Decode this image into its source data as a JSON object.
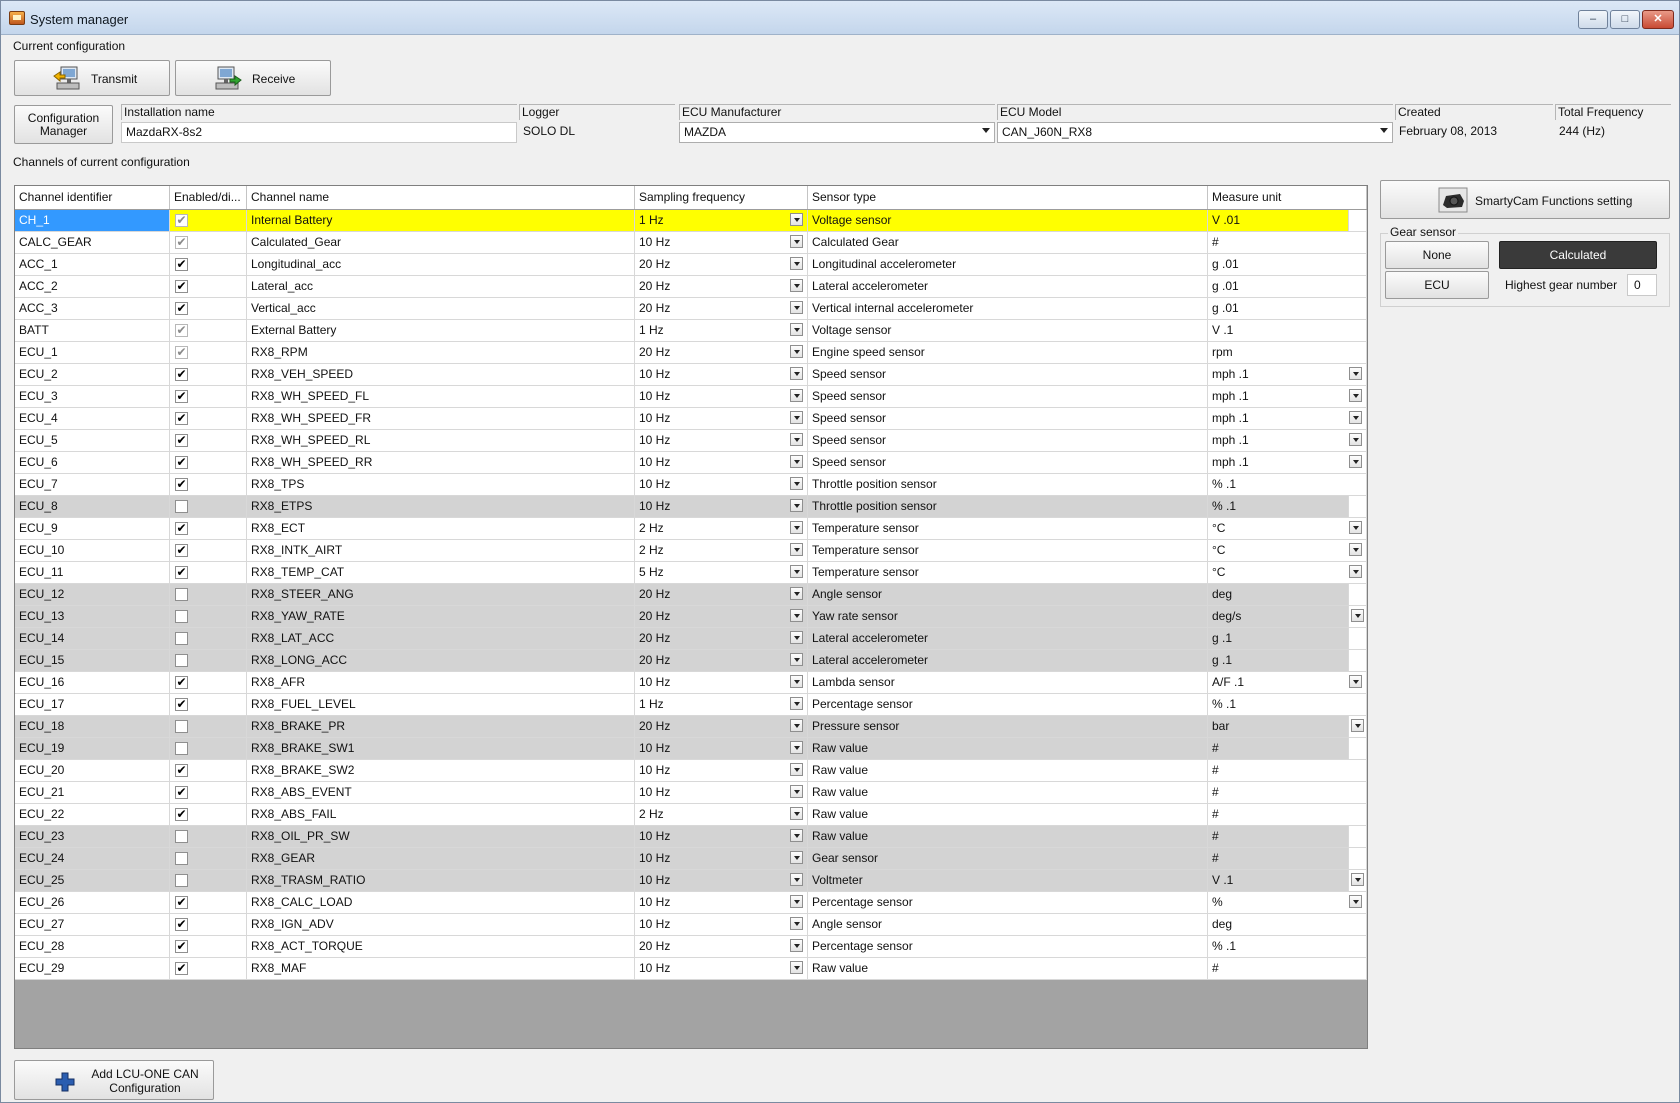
{
  "window": {
    "title": "System manager",
    "min": "–",
    "max": "□",
    "close": "✕"
  },
  "labels": {
    "current_configuration": "Current configuration",
    "channels_of_current_configuration": "Channels of current configuration"
  },
  "toolbar": {
    "transmit": "Transmit",
    "receive": "Receive",
    "configuration_manager_line1": "Configuration",
    "configuration_manager_line2": "Manager"
  },
  "fields": {
    "installation_name": {
      "label": "Installation name",
      "value": "MazdaRX-8s2"
    },
    "logger": {
      "label": "Logger",
      "value": "SOLO DL"
    },
    "ecu_manufacturer": {
      "label": "ECU Manufacturer",
      "value": "MAZDA"
    },
    "ecu_model": {
      "label": "ECU Model",
      "value": "CAN_J60N_RX8"
    },
    "created": {
      "label": "Created",
      "value": "February 08, 2013"
    },
    "total_frequency": {
      "label": "Total Frequency",
      "value": "244 (Hz)"
    }
  },
  "grid": {
    "columns": [
      "Channel identifier",
      "Enabled/di...",
      "Channel name",
      "Sampling frequency",
      "Sensor type",
      "Measure unit"
    ],
    "rows": [
      {
        "id": "CH_1",
        "enabled": true,
        "dim": true,
        "name": "Internal Battery",
        "freq": "1 Hz",
        "sensor": "Voltage sensor",
        "unit": "V .01",
        "unit_dd": false,
        "selected": true
      },
      {
        "id": "CALC_GEAR",
        "enabled": true,
        "dim": true,
        "name": "Calculated_Gear",
        "freq": "10 Hz",
        "sensor": "Calculated Gear",
        "unit": "#",
        "unit_dd": false
      },
      {
        "id": "ACC_1",
        "enabled": true,
        "name": "Longitudinal_acc",
        "freq": "20 Hz",
        "sensor": "Longitudinal accelerometer",
        "unit": "g .01",
        "unit_dd": false
      },
      {
        "id": "ACC_2",
        "enabled": true,
        "name": "Lateral_acc",
        "freq": "20 Hz",
        "sensor": "Lateral accelerometer",
        "unit": "g .01",
        "unit_dd": false
      },
      {
        "id": "ACC_3",
        "enabled": true,
        "name": "Vertical_acc",
        "freq": "20 Hz",
        "sensor": "Vertical internal accelerometer",
        "unit": "g .01",
        "unit_dd": false
      },
      {
        "id": "BATT",
        "enabled": true,
        "dim": true,
        "name": "External Battery",
        "freq": "1 Hz",
        "sensor": "Voltage sensor",
        "unit": "V .1",
        "unit_dd": false
      },
      {
        "id": "ECU_1",
        "enabled": true,
        "dim": true,
        "name": "RX8_RPM",
        "freq": "20 Hz",
        "sensor": "Engine speed sensor",
        "unit": "rpm",
        "unit_dd": false
      },
      {
        "id": "ECU_2",
        "enabled": true,
        "name": "RX8_VEH_SPEED",
        "freq": "10 Hz",
        "sensor": "Speed sensor",
        "unit": "mph .1",
        "unit_dd": true
      },
      {
        "id": "ECU_3",
        "enabled": true,
        "name": "RX8_WH_SPEED_FL",
        "freq": "10 Hz",
        "sensor": "Speed sensor",
        "unit": "mph .1",
        "unit_dd": true
      },
      {
        "id": "ECU_4",
        "enabled": true,
        "name": "RX8_WH_SPEED_FR",
        "freq": "10 Hz",
        "sensor": "Speed sensor",
        "unit": "mph .1",
        "unit_dd": true
      },
      {
        "id": "ECU_5",
        "enabled": true,
        "name": "RX8_WH_SPEED_RL",
        "freq": "10 Hz",
        "sensor": "Speed sensor",
        "unit": "mph .1",
        "unit_dd": true
      },
      {
        "id": "ECU_6",
        "enabled": true,
        "name": "RX8_WH_SPEED_RR",
        "freq": "10 Hz",
        "sensor": "Speed sensor",
        "unit": "mph .1",
        "unit_dd": true
      },
      {
        "id": "ECU_7",
        "enabled": true,
        "name": "RX8_TPS",
        "freq": "10 Hz",
        "sensor": "Throttle position sensor",
        "unit": "% .1",
        "unit_dd": false
      },
      {
        "id": "ECU_8",
        "enabled": false,
        "name": "RX8_ETPS",
        "freq": "10 Hz",
        "sensor": "Throttle position sensor",
        "unit": "% .1",
        "unit_dd": false
      },
      {
        "id": "ECU_9",
        "enabled": true,
        "name": "RX8_ECT",
        "freq": "2 Hz",
        "sensor": "Temperature sensor",
        "unit": "°C",
        "unit_dd": true
      },
      {
        "id": "ECU_10",
        "enabled": true,
        "name": "RX8_INTK_AIRT",
        "freq": "2 Hz",
        "sensor": "Temperature sensor",
        "unit": "°C",
        "unit_dd": true
      },
      {
        "id": "ECU_11",
        "enabled": true,
        "name": "RX8_TEMP_CAT",
        "freq": "5 Hz",
        "sensor": "Temperature sensor",
        "unit": "°C",
        "unit_dd": true
      },
      {
        "id": "ECU_12",
        "enabled": false,
        "name": "RX8_STEER_ANG",
        "freq": "20 Hz",
        "sensor": "Angle sensor",
        "unit": "deg",
        "unit_dd": false
      },
      {
        "id": "ECU_13",
        "enabled": false,
        "name": "RX8_YAW_RATE",
        "freq": "20 Hz",
        "sensor": "Yaw rate sensor",
        "unit": "deg/s",
        "unit_dd": true
      },
      {
        "id": "ECU_14",
        "enabled": false,
        "name": "RX8_LAT_ACC",
        "freq": "20 Hz",
        "sensor": "Lateral accelerometer",
        "unit": "g .1",
        "unit_dd": false
      },
      {
        "id": "ECU_15",
        "enabled": false,
        "name": "RX8_LONG_ACC",
        "freq": "20 Hz",
        "sensor": "Lateral accelerometer",
        "unit": "g .1",
        "unit_dd": false
      },
      {
        "id": "ECU_16",
        "enabled": true,
        "name": "RX8_AFR",
        "freq": "10 Hz",
        "sensor": "Lambda sensor",
        "unit": "A/F .1",
        "unit_dd": true
      },
      {
        "id": "ECU_17",
        "enabled": true,
        "name": "RX8_FUEL_LEVEL",
        "freq": "1 Hz",
        "sensor": "Percentage sensor",
        "unit": "% .1",
        "unit_dd": false
      },
      {
        "id": "ECU_18",
        "enabled": false,
        "name": "RX8_BRAKE_PR",
        "freq": "20 Hz",
        "sensor": "Pressure sensor",
        "unit": "bar",
        "unit_dd": true
      },
      {
        "id": "ECU_19",
        "enabled": false,
        "name": "RX8_BRAKE_SW1",
        "freq": "10 Hz",
        "sensor": "Raw value",
        "unit": "#",
        "unit_dd": false
      },
      {
        "id": "ECU_20",
        "enabled": true,
        "name": "RX8_BRAKE_SW2",
        "freq": "10 Hz",
        "sensor": "Raw value",
        "unit": "#",
        "unit_dd": false
      },
      {
        "id": "ECU_21",
        "enabled": true,
        "name": "RX8_ABS_EVENT",
        "freq": "10 Hz",
        "sensor": "Raw value",
        "unit": "#",
        "unit_dd": false
      },
      {
        "id": "ECU_22",
        "enabled": true,
        "name": "RX8_ABS_FAIL",
        "freq": "2 Hz",
        "sensor": "Raw value",
        "unit": "#",
        "unit_dd": false
      },
      {
        "id": "ECU_23",
        "enabled": false,
        "name": "RX8_OIL_PR_SW",
        "freq": "10 Hz",
        "sensor": "Raw value",
        "unit": "#",
        "unit_dd": false
      },
      {
        "id": "ECU_24",
        "enabled": false,
        "name": "RX8_GEAR",
        "freq": "10 Hz",
        "sensor": "Gear sensor",
        "unit": "#",
        "unit_dd": false
      },
      {
        "id": "ECU_25",
        "enabled": false,
        "name": "RX8_TRASM_RATIO",
        "freq": "10 Hz",
        "sensor": "Voltmeter",
        "unit": "V .1",
        "unit_dd": true
      },
      {
        "id": "ECU_26",
        "enabled": true,
        "name": "RX8_CALC_LOAD",
        "freq": "10 Hz",
        "sensor": "Percentage sensor",
        "unit": "%",
        "unit_dd": true
      },
      {
        "id": "ECU_27",
        "enabled": true,
        "name": "RX8_IGN_ADV",
        "freq": "10 Hz",
        "sensor": "Angle sensor",
        "unit": "deg",
        "unit_dd": false
      },
      {
        "id": "ECU_28",
        "enabled": true,
        "name": "RX8_ACT_TORQUE",
        "freq": "20 Hz",
        "sensor": "Percentage sensor",
        "unit": "% .1",
        "unit_dd": false
      },
      {
        "id": "ECU_29",
        "enabled": true,
        "name": "RX8_MAF",
        "freq": "10 Hz",
        "sensor": "Raw value",
        "unit": "#",
        "unit_dd": false
      }
    ]
  },
  "right_panel": {
    "smartycam_button": "SmartyCam Functions setting",
    "gear_sensor_label": "Gear sensor",
    "none_button": "None",
    "calculated_button": "Calculated",
    "ecu_button": "ECU",
    "highest_gear_label": "Highest gear number",
    "highest_gear_value": "0"
  },
  "bottom": {
    "add_button_line1": "Add LCU-ONE CAN",
    "add_button_line2": "Configuration"
  },
  "colors": {
    "selected_row": "#ffff00",
    "selected_id": "#3399ff",
    "disabled_row": "#d3d3d3",
    "active_gear_button": "#3a3a3a"
  },
  "icons": [
    "transmit-icon",
    "receive-icon",
    "smartycam-icon",
    "add-icon",
    "app-icon"
  ]
}
